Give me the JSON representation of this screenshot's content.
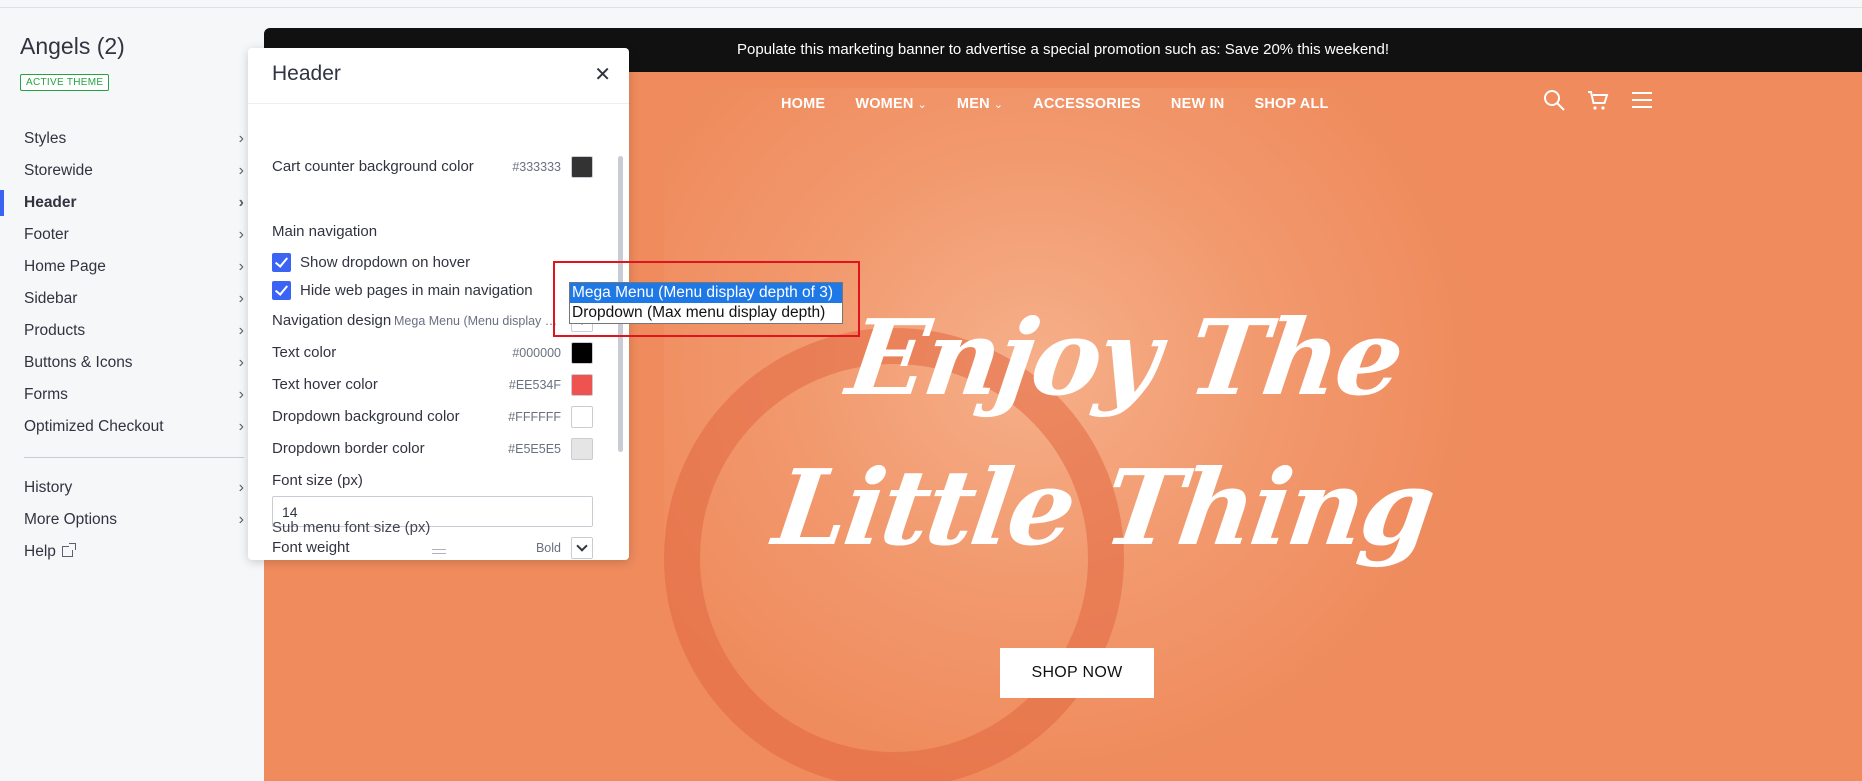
{
  "sidebar": {
    "theme_name": "Angels (2)",
    "badge": "ACTIVE THEME",
    "items": [
      {
        "label": "Styles"
      },
      {
        "label": "Storewide"
      },
      {
        "label": "Header"
      },
      {
        "label": "Footer"
      },
      {
        "label": "Home Page"
      },
      {
        "label": "Sidebar"
      },
      {
        "label": "Products"
      },
      {
        "label": "Buttons & Icons"
      },
      {
        "label": "Forms"
      },
      {
        "label": "Optimized Checkout"
      }
    ],
    "secondary": [
      {
        "label": "History"
      },
      {
        "label": "More Options"
      },
      {
        "label": "Help"
      }
    ]
  },
  "preview": {
    "banner": "Populate this marketing banner to advertise a special promotion such as: Save 20% this weekend!",
    "nav": [
      "HOME",
      "WOMEN",
      "MEN",
      "ACCESSORIES",
      "NEW IN",
      "SHOP ALL"
    ],
    "hero_line1": "Enjoy The",
    "hero_line2": "Little Thing",
    "cta": "SHOP NOW"
  },
  "panel": {
    "title": "Header",
    "cart_counter_label": "Cart counter background color",
    "cart_counter_hex": "#333333",
    "main_nav_title": "Main navigation",
    "show_dropdown_label": "Show dropdown on hover",
    "hide_pages_label": "Hide web pages in main navigation",
    "nav_design_label": "Navigation design",
    "nav_design_value": "Mega Menu (Menu display depth of 3)",
    "text_color_label": "Text color",
    "text_color_hex": "#000000",
    "text_hover_label": "Text hover color",
    "text_hover_hex": "#EE534F",
    "dropdown_bg_label": "Dropdown background color",
    "dropdown_bg_hex": "#FFFFFF",
    "dropdown_border_label": "Dropdown border color",
    "dropdown_border_hex": "#E5E5E5",
    "font_size_label": "Font size (px)",
    "font_size_value": "14",
    "font_weight_label": "Font weight",
    "font_weight_value": "Bold",
    "sub_menu_label": "Sub menu font size (px)"
  },
  "dropdown": {
    "options": [
      "Mega Menu (Menu display depth of 3)",
      "Dropdown (Max menu display depth)"
    ]
  },
  "colors": {
    "accent": "#3c64f4",
    "badge_green": "#27a243",
    "hero_bg": "#ef8b5d",
    "selection_blue": "#1e78e6",
    "annotation_red": "#e0141e"
  }
}
